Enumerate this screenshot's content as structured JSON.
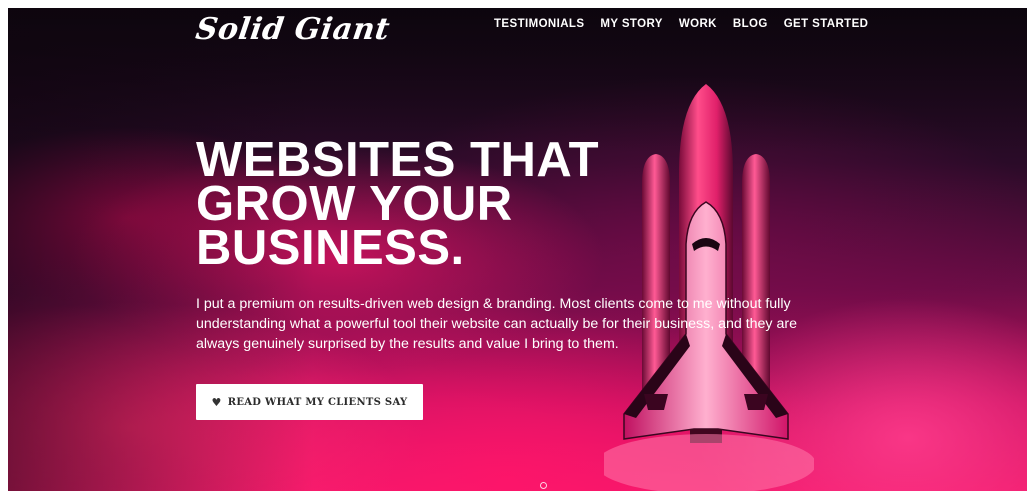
{
  "brand": {
    "logo_text": "Solid Giant"
  },
  "nav": {
    "items": [
      {
        "label": "TESTIMONIALS"
      },
      {
        "label": "MY STORY"
      },
      {
        "label": "WORK"
      },
      {
        "label": "BLOG"
      },
      {
        "label": "GET STARTED"
      }
    ]
  },
  "hero": {
    "headline_lines": [
      "WEBSITES THAT",
      "GROW YOUR",
      "BUSINESS."
    ],
    "tagline": "I put a premium on results-driven web design & branding. Most clients come to me without fully understanding what a powerful tool their website can actually be for their business, and they are always genuinely surprised by the results and value I bring to them.",
    "cta_label": "READ WHAT MY CLIENTS SAY",
    "cta_icon": "heart-icon"
  },
  "colors": {
    "accent_pink": "#f01a6d",
    "dark_background": "#120812",
    "button_background": "#ffffff"
  }
}
